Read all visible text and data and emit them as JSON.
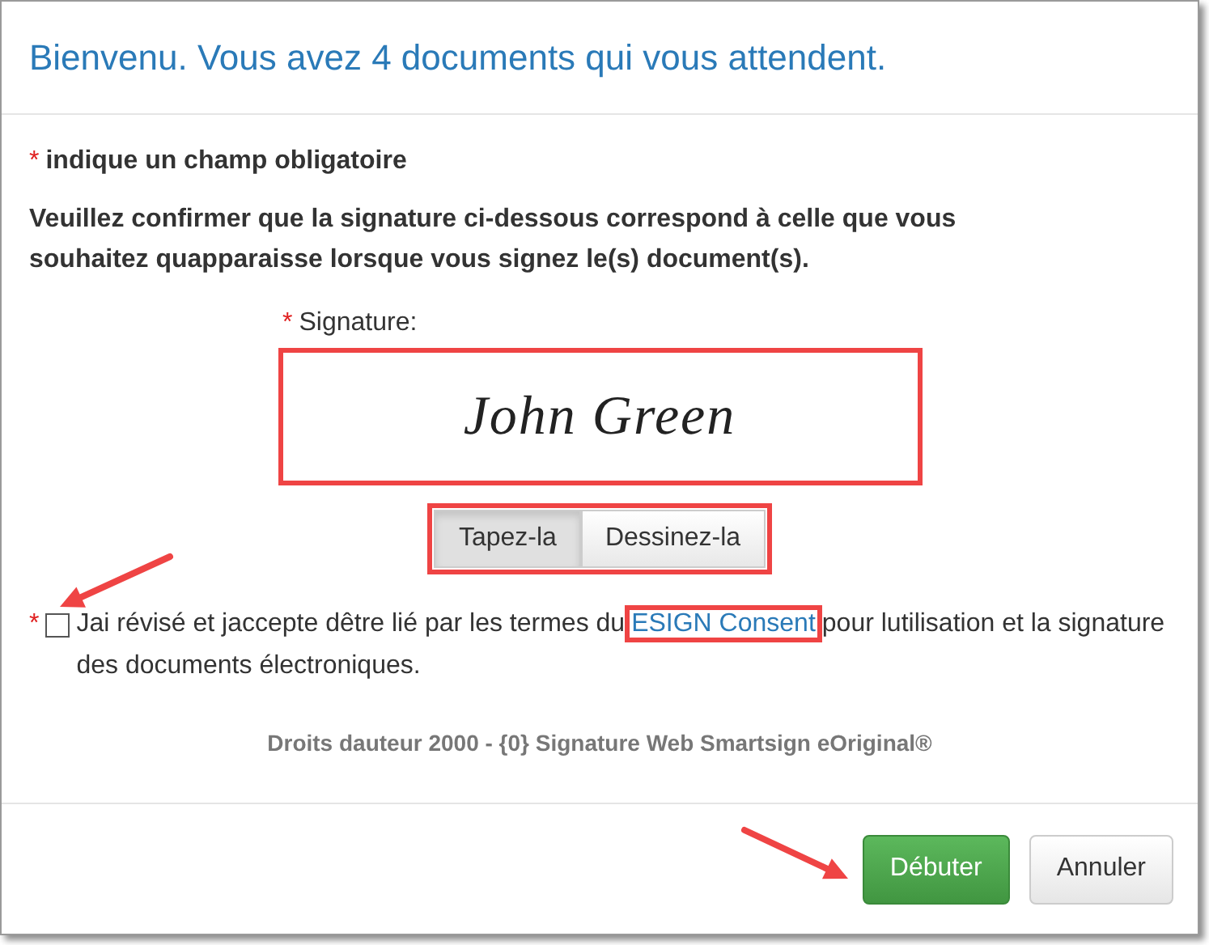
{
  "header": {
    "title": "Bienvenu. Vous avez 4 documents qui vous attendent."
  },
  "required_note": {
    "mark": "*",
    "text": "indique un champ obligatoire"
  },
  "instruction": "Veuillez confirmer que la signature ci-dessous correspond à celle que vous souhaitez quapparaisse lorsque vous signez le(s) document(s).",
  "signature": {
    "mark": "*",
    "label": "Signature:",
    "value": "John Green"
  },
  "signature_modes": [
    {
      "label": "Tapez-la",
      "selected": true
    },
    {
      "label": "Dessinez-la",
      "selected": false
    }
  ],
  "consent": {
    "mark": "*",
    "checked": false,
    "text_before": "Jai révisé et jaccepte dêtre lié par les termes du",
    "link": "ESIGN Consent",
    "text_after": "pour lutilisation et la signature des documents électroniques."
  },
  "copyright": "Droits dauteur 2000 - {0} Signature Web Smartsign eOriginal®",
  "buttons": [
    {
      "label": "Débuter",
      "kind": "primary"
    },
    {
      "label": "Annuler",
      "kind": "default"
    }
  ]
}
